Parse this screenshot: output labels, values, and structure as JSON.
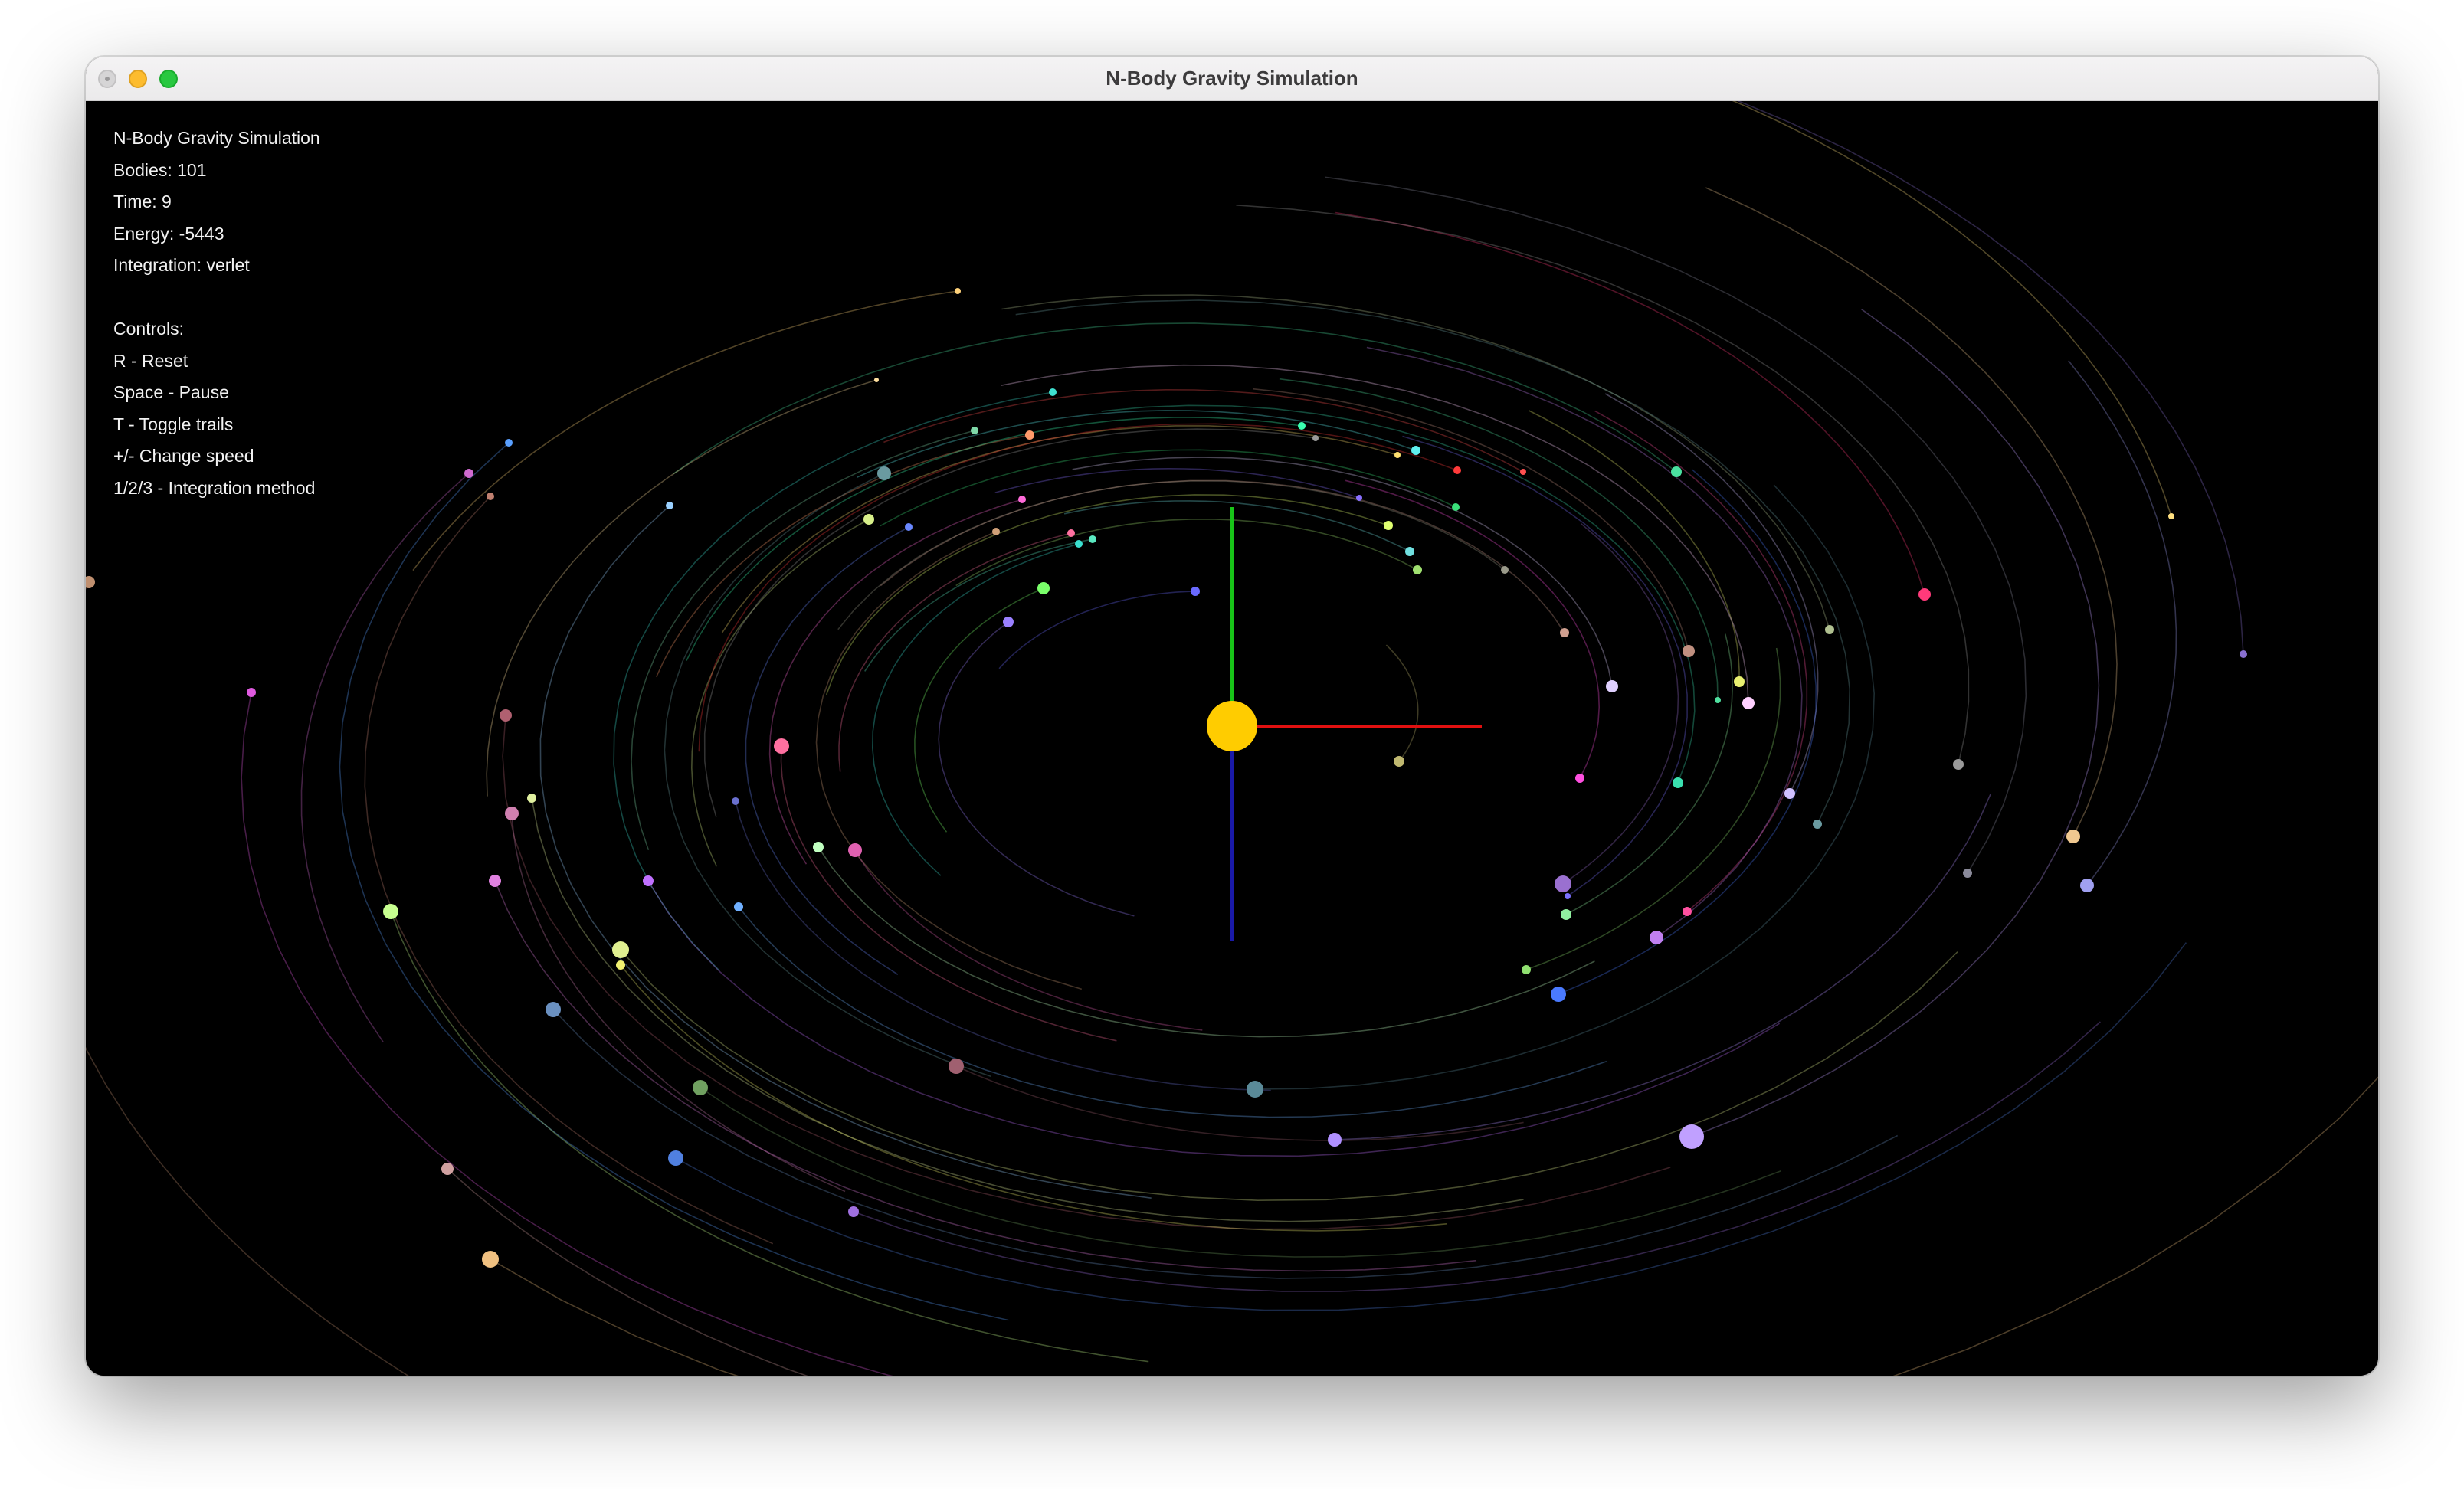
{
  "window": {
    "title": "N-Body Gravity Simulation"
  },
  "hud": {
    "heading": "N-Body Gravity Simulation",
    "bodies": "Bodies: 101",
    "time": "Time: 9",
    "energy": "Energy: -5443",
    "integration": "Integration: verlet",
    "controls_title": "Controls:",
    "controls": [
      "R - Reset",
      "Space - Pause",
      "T - Toggle trails",
      "+/- Change speed",
      "1/2/3 - Integration method"
    ]
  },
  "simulation": {
    "background": "#000000",
    "sun_color": "#ffcc00",
    "axis_colors": {
      "x": "#e01010",
      "y": "#18c418",
      "z": "#1a1aa8"
    }
  }
}
